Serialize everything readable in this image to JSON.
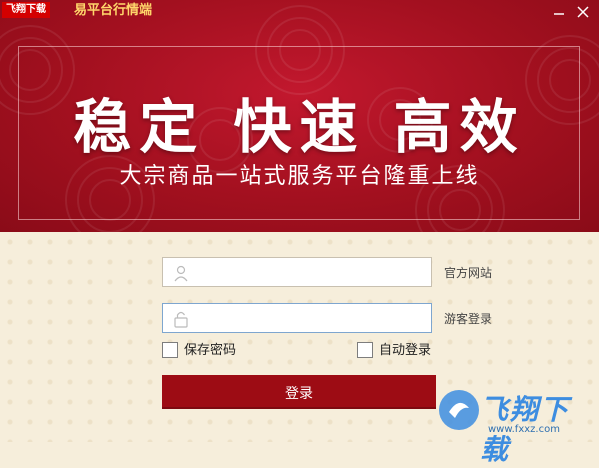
{
  "window": {
    "logo_text": "飞翔下载",
    "title": "易平台行情端",
    "minimize_icon": "minimize-icon",
    "close_icon": "close-icon"
  },
  "banner": {
    "headline": "稳定 快速 高效",
    "subline": "大宗商品一站式服务平台隆重上线"
  },
  "login": {
    "username_value": "",
    "username_icon": "user-icon",
    "password_value": "",
    "password_icon": "lock-icon",
    "link_official": "官方网站",
    "link_guest": "游客登录",
    "remember_label": "保存密码",
    "autologin_label": "自动登录",
    "remember_checked": false,
    "autologin_checked": false,
    "login_button": "登录"
  },
  "watermark": {
    "text": "飞翔下载",
    "url": "www.fxxz.com"
  },
  "colors": {
    "banner": "#a2101f",
    "button": "#9d0c14",
    "title": "#ffd76b",
    "background": "#f6eedb"
  }
}
